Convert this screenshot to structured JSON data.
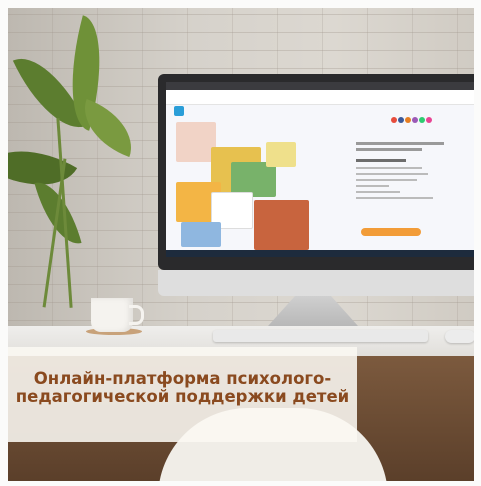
{
  "caption": {
    "text": "Онлайн-платформа психолого-педагогической поддержки детей"
  },
  "colors": {
    "caption_text": "#8a4a1f",
    "caption_background": "#fbf8f3",
    "accent_orange": "#f29c38",
    "accent_blue": "#2a9ed8"
  }
}
